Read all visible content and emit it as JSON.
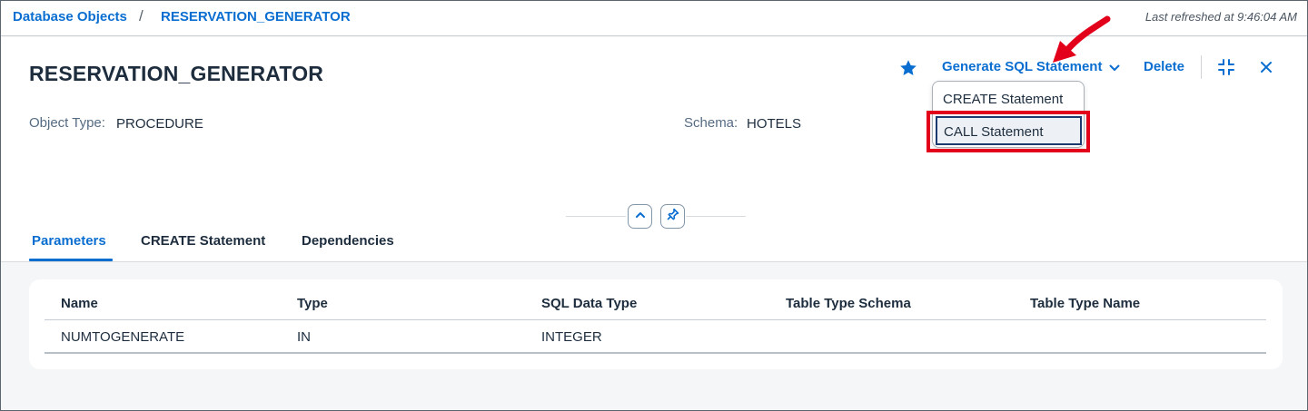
{
  "breadcrumb": {
    "items": [
      "Database Objects",
      "RESERVATION_GENERATOR"
    ],
    "separator": "/"
  },
  "status": {
    "last_refreshed": "Last refreshed at 9:46:04 AM"
  },
  "object": {
    "title": "RESERVATION_GENERATOR",
    "type_label": "Object Type:",
    "type_value": "PROCEDURE",
    "schema_label": "Schema:",
    "schema_value": "HOTELS"
  },
  "actions": {
    "favorite_icon": "star-icon",
    "generate_label": "Generate SQL Statement",
    "delete_label": "Delete",
    "collapse_icon": "exit-fullscreen-icon",
    "close_icon": "close-icon"
  },
  "generate_menu": {
    "items": [
      "CREATE Statement",
      "CALL Statement"
    ],
    "highlighted": "CALL Statement"
  },
  "tabs": [
    {
      "label": "Parameters",
      "active": true
    },
    {
      "label": "CREATE Statement",
      "active": false
    },
    {
      "label": "Dependencies",
      "active": false
    }
  ],
  "parameters_table": {
    "columns": [
      "Name",
      "Type",
      "SQL Data Type",
      "Table Type Schema",
      "Table Type Name"
    ],
    "rows": [
      [
        "NUMTOGENERATE",
        "IN",
        "INTEGER",
        "",
        ""
      ]
    ]
  },
  "colors": {
    "accent": "#0a6ed1",
    "annotation_red": "#e3001b",
    "background": "#f5f6f7"
  }
}
